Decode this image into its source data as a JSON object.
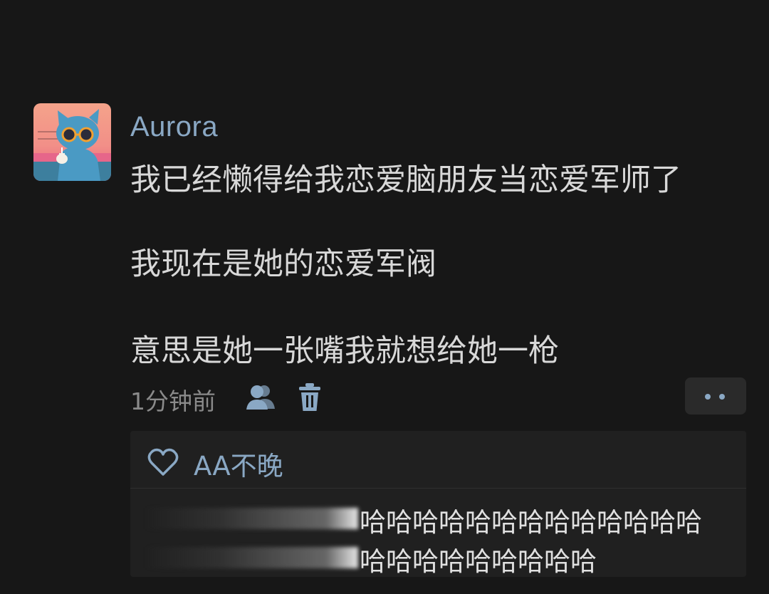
{
  "post": {
    "author": "Aurora",
    "avatar_icon": "cool-cat-with-sunglasses",
    "lines": [
      "我已经懒得给我恋爱脑朋友当恋爱军师了",
      "我现在是她的恋爱军阀",
      "意思是她一张嘴我就想给她一枪"
    ],
    "timestamp": "1分钟前"
  },
  "actions": {
    "visibility_icon": "friends-icon",
    "delete_icon": "trash-icon",
    "more_icon": "more-dots-icon"
  },
  "likes": {
    "icon": "heart-outline-icon",
    "names": "AA不晚"
  },
  "comments": [
    {
      "text": "哈哈哈哈哈哈哈哈哈哈哈哈哈"
    },
    {
      "text": "哈哈哈哈哈哈哈哈哈"
    }
  ],
  "colors": {
    "background": "#171717",
    "accent": "#8aa8c4",
    "text": "#d8d8d8",
    "muted": "#8a8a8a",
    "panel": "#202020"
  }
}
